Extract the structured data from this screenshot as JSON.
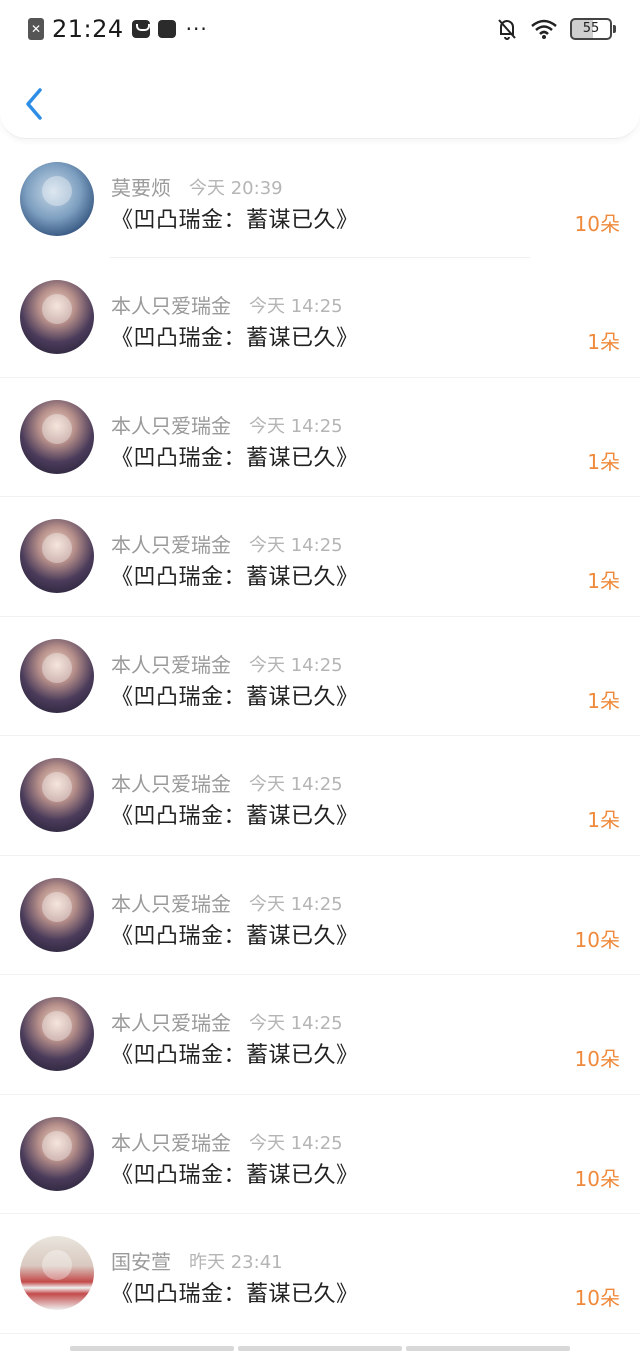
{
  "status_bar": {
    "time": "21:24",
    "battery": "55",
    "dots": "···"
  },
  "colors": {
    "accent": "#ef8a3c",
    "back": "#2e8ee6"
  },
  "gifts": [
    {
      "name": "莫要烦",
      "time": "今天 20:39",
      "title": "《凹凸瑞金：蓄谋已久》",
      "count": "10朵",
      "avatar": "anime-boy"
    },
    {
      "name": "本人只爱瑞金",
      "time": "今天 14:25",
      "title": "《凹凸瑞金：蓄谋已久》",
      "count": "1朵",
      "avatar": "anime-girl"
    },
    {
      "name": "本人只爱瑞金",
      "time": "今天 14:25",
      "title": "《凹凸瑞金：蓄谋已久》",
      "count": "1朵",
      "avatar": "anime-girl"
    },
    {
      "name": "本人只爱瑞金",
      "time": "今天 14:25",
      "title": "《凹凸瑞金：蓄谋已久》",
      "count": "1朵",
      "avatar": "anime-girl"
    },
    {
      "name": "本人只爱瑞金",
      "time": "今天 14:25",
      "title": "《凹凸瑞金：蓄谋已久》",
      "count": "1朵",
      "avatar": "anime-girl"
    },
    {
      "name": "本人只爱瑞金",
      "time": "今天 14:25",
      "title": "《凹凸瑞金：蓄谋已久》",
      "count": "1朵",
      "avatar": "anime-girl"
    },
    {
      "name": "本人只爱瑞金",
      "time": "今天 14:25",
      "title": "《凹凸瑞金：蓄谋已久》",
      "count": "10朵",
      "avatar": "anime-girl"
    },
    {
      "name": "本人只爱瑞金",
      "time": "今天 14:25",
      "title": "《凹凸瑞金：蓄谋已久》",
      "count": "10朵",
      "avatar": "anime-girl"
    },
    {
      "name": "本人只爱瑞金",
      "time": "今天 14:25",
      "title": "《凹凸瑞金：蓄谋已久》",
      "count": "10朵",
      "avatar": "anime-girl"
    },
    {
      "name": "国安萱",
      "time": "昨天 23:41",
      "title": "《凹凸瑞金：蓄谋已久》",
      "count": "10朵",
      "avatar": "striped-girl"
    }
  ]
}
